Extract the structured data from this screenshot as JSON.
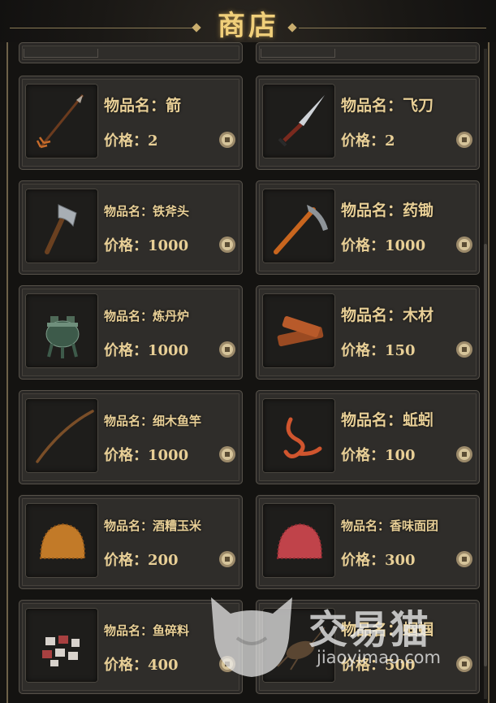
{
  "header": {
    "title": "商店"
  },
  "items": [
    {
      "name": "物品名：箭",
      "price": "价格：2",
      "icon": "arrow-icon"
    },
    {
      "name": "物品名：飞刀",
      "price": "价格：2",
      "icon": "throwing-knife-icon"
    },
    {
      "name": "物品名：铁斧头",
      "price": "价格：1000",
      "icon": "iron-axe-icon"
    },
    {
      "name": "物品名：药锄",
      "price": "价格：1000",
      "icon": "herb-hoe-icon"
    },
    {
      "name": "物品名：炼丹炉",
      "price": "价格：1000",
      "icon": "alchemy-furnace-icon"
    },
    {
      "name": "物品名：木材",
      "price": "价格：150",
      "icon": "wood-icon"
    },
    {
      "name": "物品名：细木鱼竿",
      "price": "价格：1000",
      "icon": "fishing-rod-icon"
    },
    {
      "name": "物品名：蚯蚓",
      "price": "价格：100",
      "icon": "earthworm-icon"
    },
    {
      "name": "物品名：酒糟玉米",
      "price": "价格：200",
      "icon": "corn-bait-icon"
    },
    {
      "name": "物品名：香味面团",
      "price": "价格：300",
      "icon": "dough-bait-icon"
    },
    {
      "name": "物品名：鱼碎料",
      "price": "价格：400",
      "icon": "fish-bits-icon"
    },
    {
      "name": "物品名：蝈蝈",
      "price": "价格：500",
      "icon": "cricket-icon"
    }
  ],
  "watermark": {
    "brand": "交易猫",
    "url": "jiaoyimao.com"
  }
}
